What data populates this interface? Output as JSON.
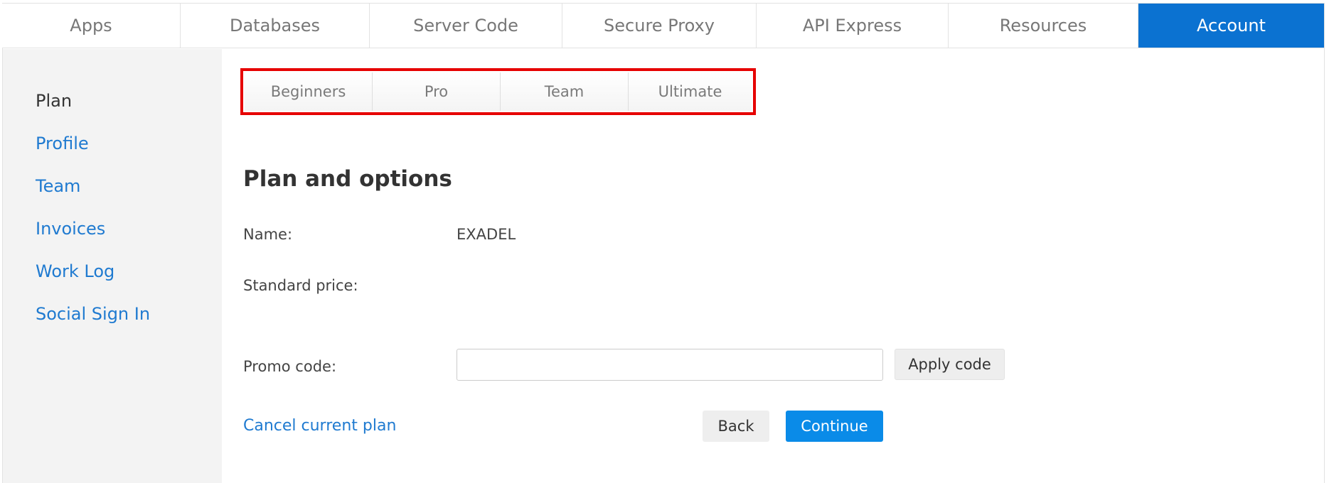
{
  "topnav": {
    "tabs": [
      {
        "label": "Apps"
      },
      {
        "label": "Databases"
      },
      {
        "label": "Server Code"
      },
      {
        "label": "Secure Proxy"
      },
      {
        "label": "API Express"
      },
      {
        "label": "Resources"
      },
      {
        "label": "Account"
      }
    ],
    "active_tab": "Account",
    "active_color": "#0b72d1"
  },
  "sidebar": {
    "items": [
      {
        "label": "Plan"
      },
      {
        "label": "Profile"
      },
      {
        "label": "Team"
      },
      {
        "label": "Invoices"
      },
      {
        "label": "Work Log"
      },
      {
        "label": "Social Sign In"
      }
    ],
    "current_item": "Plan",
    "link_color": "#1f7ad0"
  },
  "plan_tabs": {
    "tabs": [
      {
        "label": "Beginners"
      },
      {
        "label": "Pro"
      },
      {
        "label": "Team"
      },
      {
        "label": "Ultimate"
      }
    ],
    "highlight_color": "#e60000"
  },
  "main": {
    "heading": "Plan and options",
    "name_label": "Name:",
    "name_value": "EXADEL",
    "price_label": "Standard price:",
    "promo_label": "Promo code:",
    "promo_value": "",
    "apply_label": "Apply code",
    "cancel_label": "Cancel current plan",
    "back_label": "Back",
    "continue_label": "Continue",
    "continue_color": "#0a8be8"
  }
}
